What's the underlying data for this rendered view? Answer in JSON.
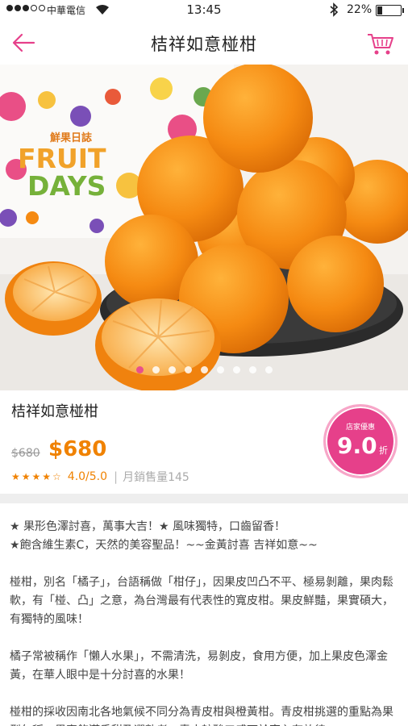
{
  "status_bar": {
    "carrier": "中華電信",
    "time": "13:45",
    "battery": "22%",
    "battery_level": 0.22
  },
  "nav": {
    "title": "桔祥如意椪柑"
  },
  "hero": {
    "box_text_cn": "鮮果日誌",
    "box_text_1": "FRUIT",
    "box_text_2": "DAYS",
    "slide_count": 9,
    "active_slide": 1
  },
  "product": {
    "name": "桔祥如意椪柑",
    "old_price": "$680",
    "price": "$680",
    "stars": "★★★★☆",
    "rating": "4.0/5.0",
    "sales": "月銷售量145",
    "discount_label": "店家優惠",
    "discount_value": "9.0",
    "discount_unit": "折"
  },
  "description": [
    "★ 果形色澤討喜，萬事大吉！★ 風味獨特，口齒留香！\n★飽含維生素C，天然的美容聖品！~~金黃討喜 吉祥如意~~",
    "椪柑，別名「橘子」，台語稱做「柑仔」，因果皮凹凸不平、極易剝離，果肉鬆軟，有「椪、凸」之意，為台灣最有代表性的寬皮柑。果皮鮮豔，果實碩大，有獨特的風味！",
    "橘子常被稱作「懶人水果」，不需清洗，易剝皮，食用方便，加上果皮色澤金黃，在華人眼中是十分討喜的水果！",
    "椪柑的採收因南北各地氣候不同分為青皮柑與橙黃柑。青皮柑挑選的重點為果型勻稱，果實飽滿香甜及選熟者，青皮較酸口感可於室內存放待"
  ],
  "colors": {
    "accent": "#e6408a",
    "price": "#f08200"
  }
}
